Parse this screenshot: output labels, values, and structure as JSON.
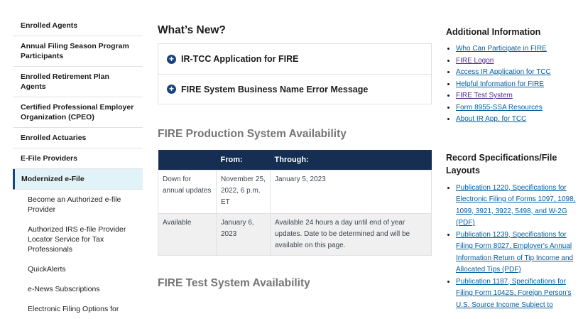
{
  "sidebar": {
    "items": [
      {
        "label": "Enrolled Agents"
      },
      {
        "label": "Annual Filing Season Program Participants"
      },
      {
        "label": "Enrolled Retirement Plan Agents"
      },
      {
        "label": "Certified Professional Employer Organization (CPEO)"
      },
      {
        "label": "Enrolled Actuaries"
      },
      {
        "label": "E-File Providers"
      },
      {
        "label": "Modernized e-File"
      }
    ],
    "subitems": [
      {
        "label": "Become an Authorized e-file Provider"
      },
      {
        "label": "Authorized IRS e-file Provider Locator Service for Tax Professionals"
      },
      {
        "label": "QuickAlerts"
      },
      {
        "label": "e-News Subscriptions"
      },
      {
        "label": "Electronic Filing Options for"
      }
    ]
  },
  "main": {
    "whats_new_title": "What’s New?",
    "accordion": [
      {
        "label": "IR-TCC Application for FIRE"
      },
      {
        "label": "FIRE System Business Name Error Message"
      }
    ],
    "production_title": "FIRE Production System Availability",
    "table": {
      "headers": [
        "",
        "From:",
        "Through:"
      ],
      "rows": [
        [
          "Down for annual updates",
          "November 25, 2022, 6 p.m. ET",
          "January 5, 2023"
        ],
        [
          "Available",
          "January 6, 2023",
          "Available 24 hours a day until end of year updates. Date to be determined and will be available on this page."
        ]
      ]
    },
    "test_title": "FIRE Test System Availability"
  },
  "right": {
    "additional_title": "Additional Information",
    "additional_links": [
      "Who Can Participate in FIRE",
      "FIRE Logon",
      "Access IR Application for TCC",
      "Helpful Information for FIRE",
      "FIRE Test System",
      "Form 8955-SSA Resources",
      "About IR App. for TCC"
    ],
    "record_title": "Record Specifications/File Layouts",
    "record_links": [
      "Publication 1220, Specifications for Electronic Filing of Forms 1097, 1098, 1099, 3921, 3922, 5498, and W-2G (PDF)",
      "Publication 1239, Specifications for Filing Form 8027, Employer's Annual Information Return of Tip Income and Allocated Tips (PDF)",
      "Publication 1187, Specifications for Filing Form 1042S, Foreign Person's U.S. Source Income Subject to"
    ]
  },
  "colors": {
    "nav_blue": "#1a4480",
    "table_header": "#162e51",
    "link": "#005ea2",
    "visited_link": "#54278f",
    "active_bg": "#e1f3f8"
  }
}
